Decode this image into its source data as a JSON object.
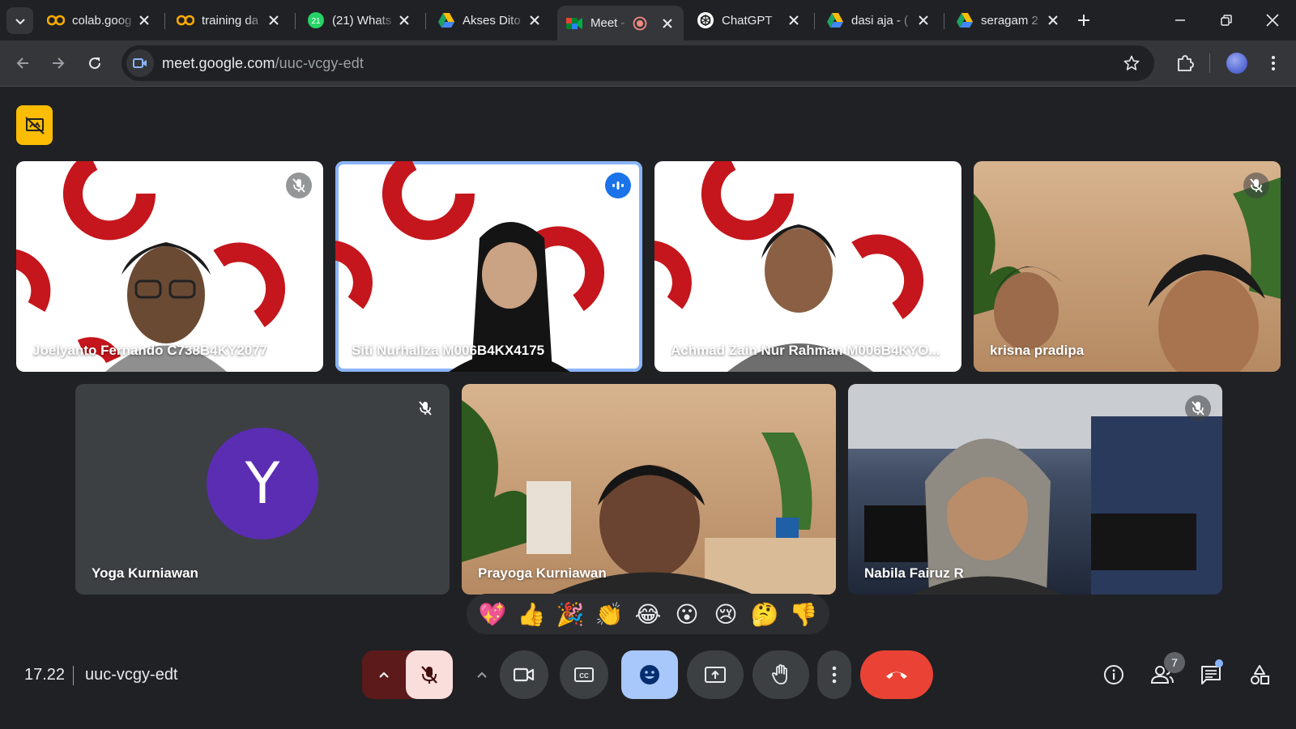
{
  "browser": {
    "tabs": [
      {
        "title": "colab.goog",
        "icon": "colab-icon"
      },
      {
        "title": "training da",
        "icon": "colab-icon"
      },
      {
        "title": "(21) Whats",
        "icon": "whatsapp-icon",
        "badge": "21"
      },
      {
        "title": "Akses Dito",
        "icon": "google-drive-icon"
      },
      {
        "title": "Meet -",
        "icon": "google-meet-icon",
        "active": true,
        "recording": true
      },
      {
        "title": "ChatGPT",
        "icon": "chatgpt-icon"
      },
      {
        "title": "dasi aja - (",
        "icon": "google-drive-icon"
      },
      {
        "title": "seragam 2",
        "icon": "google-drive-icon"
      }
    ],
    "url_domain": "meet.google.com",
    "url_path": "/uuc-vcgy-edt"
  },
  "meet": {
    "participants": [
      {
        "name": "Joelyanto Fernando C738B4KY2077",
        "muted": true,
        "background": "brand"
      },
      {
        "name": "Siti Nurhaliza M006B4KX4175",
        "speaking": true,
        "background": "brand"
      },
      {
        "name": "Achmad Zain Nur Rahman M006B4KYO...",
        "background": "brand"
      },
      {
        "name": "krisna pradipa",
        "muted": true,
        "background": "wood"
      },
      {
        "name": "Yoga Kurniawan",
        "muted": true,
        "avatar_letter": "Y",
        "avatar_color": "#5b2db3"
      },
      {
        "name": "Prayoga Kurniawan",
        "background": "wood"
      },
      {
        "name": "Nabila Fairuz R",
        "muted": true,
        "background": "office"
      }
    ],
    "reactions": [
      "💖",
      "👍",
      "🎉",
      "👏",
      "😂",
      "😮",
      "😢",
      "🤔",
      "👎"
    ],
    "clock": "17.22",
    "meeting_code": "uuc-vcgy-edt",
    "people_count": "7"
  },
  "colors": {
    "chrome_bg": "#202124",
    "toolbar_bg": "#35363a",
    "accent_blue": "#8ab4f8",
    "hangup_red": "#ea4335",
    "host_yellow": "#fbbc04",
    "brand_red": "#c4161c"
  }
}
